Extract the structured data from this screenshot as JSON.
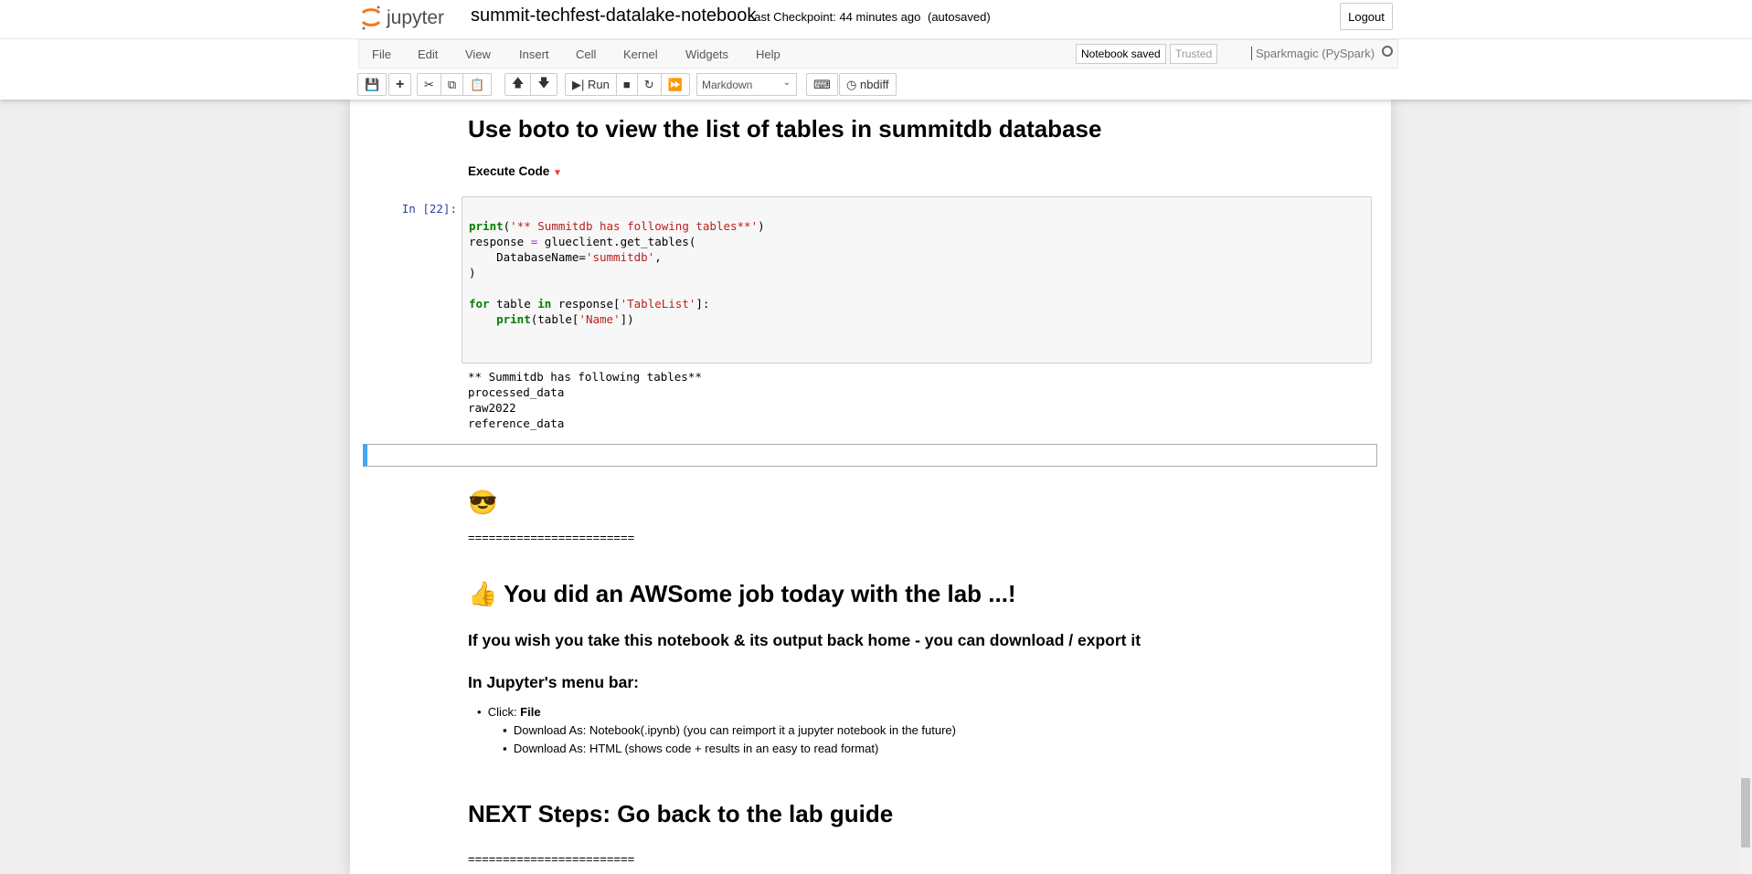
{
  "header": {
    "notebook_title": "summit-techfest-datalake-notebook",
    "checkpoint": "Last Checkpoint: 44 minutes ago",
    "autosave": "(autosaved)",
    "logout_label": "Logout",
    "logo_text": "jupyter"
  },
  "menu": {
    "items": [
      "File",
      "Edit",
      "View",
      "Insert",
      "Cell",
      "Kernel",
      "Widgets",
      "Help"
    ],
    "notebook_saved": "Notebook saved",
    "trusted": "Trusted",
    "kernel_name": "Sparkmagic (PySpark)"
  },
  "toolbar": {
    "run_label": "Run",
    "cell_type": "Markdown",
    "nbdiff_label": "nbdiff",
    "icons": [
      "save-icon",
      "plus-icon",
      "cut-icon",
      "copy-icon",
      "paste-icon",
      "arrow-up-icon",
      "arrow-down-icon",
      "step-forward-icon",
      "stop-icon",
      "refresh-icon",
      "fast-forward-icon",
      "keyboard-icon",
      "clock-icon"
    ]
  },
  "cells": {
    "heading1": "Use boto to view the list of tables in summitdb database",
    "execute_code": "Execute Code",
    "prompt": "In [22]:",
    "code_lines": [
      "print('** Summitdb has following tables**')",
      "response = glueclient.get_tables(",
      "    DatabaseName='summitdb',",
      ")",
      "",
      "for table in response['TableList']:",
      "    print(table['Name'])"
    ],
    "output_lines": [
      "** Summitdb has following tables**",
      "processed_data",
      "raw2022",
      "reference_data"
    ],
    "separator": "========================",
    "awsome_heading": "You did an AWSome job today with the lab ...!",
    "download_heading": "If you wish you take this notebook & its output back home - you can download / export it",
    "menu_bar_heading": "In Jupyter's menu bar:",
    "click_label": "Click: ",
    "click_bold": "File",
    "sub_items": [
      "Download As: Notebook(.ipynb) (you can reimport it a jupyter notebook in the future)",
      "Download As: HTML (shows code + results in an easy to read format)"
    ],
    "next_heading": "NEXT Steps: Go back to the lab guide",
    "separator2": "========================"
  }
}
